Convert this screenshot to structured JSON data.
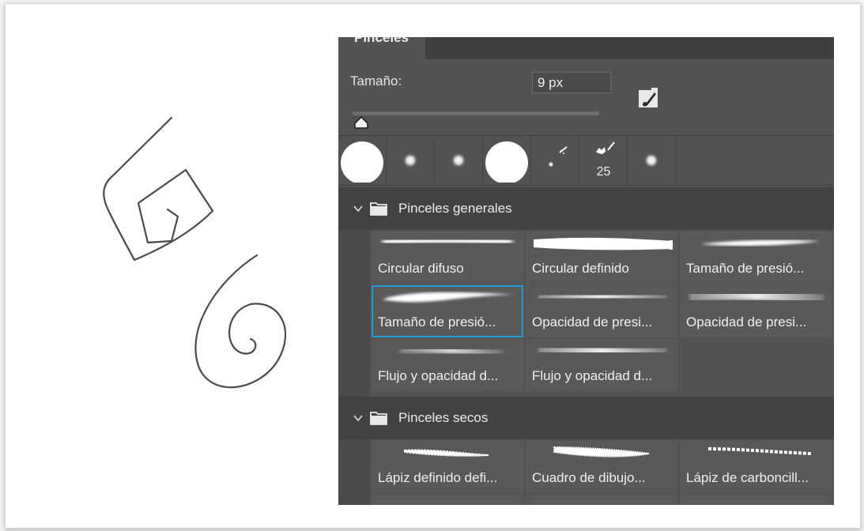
{
  "panel": {
    "tab_title": "Pinceles",
    "size_label": "Tamaño:",
    "size_value": "9 px",
    "size_slider_fraction": 0.02,
    "presets": [
      {
        "icon": "hard-round-brush-icon",
        "label": ""
      },
      {
        "icon": "soft-round-brush-icon",
        "label": ""
      },
      {
        "icon": "soft-round-brush-icon",
        "label": ""
      },
      {
        "icon": "hard-round-brush-icon",
        "label": ""
      },
      {
        "icon": "scatter-brush-icon",
        "label": ""
      },
      {
        "icon": "splatter-brush-icon",
        "label": "25"
      },
      {
        "icon": "soft-round-brush-icon",
        "label": ""
      }
    ],
    "groups": [
      {
        "name": "Pinceles generales",
        "brushes": [
          "Circular difuso",
          "Circular definido",
          "Tamaño de presió...",
          "Tamaño de presió...",
          "Opacidad de presi...",
          "Opacidad de presi...",
          "Flujo y opacidad d...",
          "Flujo y opacidad d..."
        ]
      },
      {
        "name": "Pinceles secos",
        "brushes": [
          "Lápiz definido defi...",
          "Cuadro de dibujo...",
          "Lápiz de carboncill..."
        ]
      }
    ],
    "selected_brush": "Tamaño de presió...",
    "accent_color": "#1c9bd6",
    "panel_color": "#535353"
  }
}
